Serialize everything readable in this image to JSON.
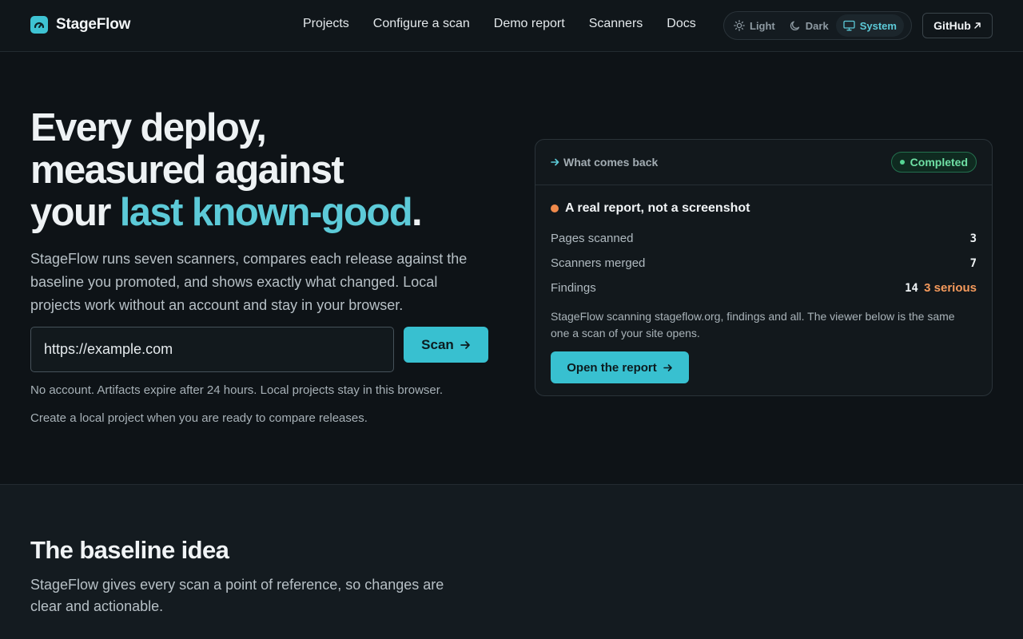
{
  "header": {
    "brand": "StageFlow",
    "nav": [
      "Projects",
      "Configure a scan",
      "Demo report",
      "Scanners",
      "Docs"
    ],
    "theme": {
      "light": "Light",
      "dark": "Dark",
      "system": "System",
      "active": "System"
    },
    "github": "GitHub"
  },
  "hero": {
    "title_line1": "Every deploy,",
    "title_line2": "measured against",
    "title_prefix": "your ",
    "title_accent": "last known-good",
    "title_suffix": ".",
    "subtitle": "StageFlow runs seven scanners, compares each release against the baseline you promoted, and shows exactly what changed. Local projects work without an account and stay in your browser.",
    "url_value": "https://example.com",
    "scan_label": "Scan",
    "note1": "No account. Artifacts expire after 24 hours. Local projects stay in this browser.",
    "note2": "Create a local project when you are ready to compare releases."
  },
  "card": {
    "kicker": "What comes back",
    "status": "Completed",
    "title": "A real report, not a screenshot",
    "stats": [
      {
        "label": "Pages scanned",
        "value": "3"
      },
      {
        "label": "Scanners merged",
        "value": "7"
      },
      {
        "label": "Findings",
        "value": "14",
        "extra": "3 serious"
      }
    ],
    "description": "StageFlow scanning stageflow.org, findings and all. The viewer below is the same one a scan of your site opens.",
    "button": "Open the report"
  },
  "baseline": {
    "title": "The baseline idea",
    "subtitle": "StageFlow gives every scan a point of reference, so changes are clear and actionable."
  },
  "colors": {
    "accent": "#38c0d0",
    "background": "#0e1317",
    "success": "#55d493",
    "warning": "#f59a5c"
  },
  "icons": [
    "stageflow-logo-icon",
    "sun-icon",
    "moon-icon",
    "monitor-icon",
    "external-arrow-icon",
    "arrow-right-icon"
  ]
}
